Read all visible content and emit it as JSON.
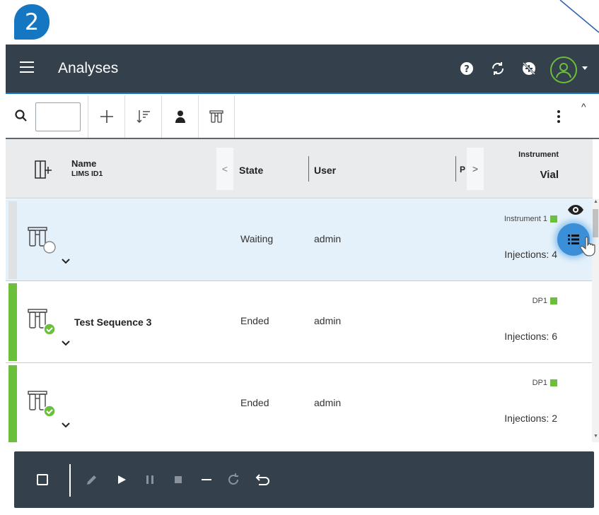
{
  "step_badge": "2",
  "header": {
    "title": "Analyses",
    "icons": [
      "hamburger-menu-icon",
      "help-icon",
      "sync-icon",
      "offline-icon",
      "user-avatar-icon"
    ]
  },
  "toolbar": {
    "search_value": "",
    "icons": [
      "search-icon",
      "add-icon",
      "sort-icon",
      "person-filter-icon",
      "sequence-icon",
      "more-options-icon"
    ]
  },
  "columns": {
    "name": "Name",
    "name_sub": "LIMS ID1",
    "state": "State",
    "user": "User",
    "p": "P",
    "instrument": "Instrument",
    "vial": "Vial"
  },
  "rows": [
    {
      "name": "",
      "state": "Waiting",
      "user": "admin",
      "instrument": "Instrument 1",
      "injections": "Injections: 4",
      "status_color": "#dfe2e4",
      "status_icon": "waiting-circle-icon",
      "selected": true
    },
    {
      "name": "Test Sequence 3",
      "state": "Ended",
      "user": "admin",
      "instrument": "DP1",
      "injections": "Injections: 6",
      "status_color": "#6abf3c",
      "status_icon": "check-circle-icon",
      "selected": false
    },
    {
      "name": "",
      "state": "Ended",
      "user": "admin",
      "instrument": "DP1",
      "injections": "Injections: 2",
      "status_color": "#6abf3c",
      "status_icon": "check-circle-icon",
      "selected": false
    }
  ],
  "action_bar": {
    "icons": [
      "select-all-checkbox",
      "edit-icon",
      "play-icon",
      "pause-icon",
      "stop-icon",
      "minus-icon",
      "refresh-icon",
      "undo-icon"
    ]
  },
  "colors": {
    "topbar": "#34404b",
    "accent": "#1577c2",
    "success": "#6abf3c",
    "selected_row": "#e4f1fa"
  }
}
